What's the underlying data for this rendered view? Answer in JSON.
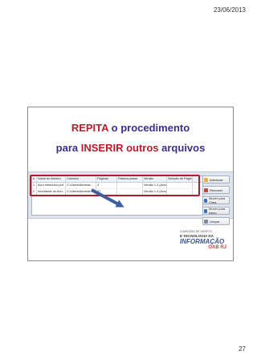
{
  "page": {
    "date": "23/06/2013",
    "number": "27"
  },
  "slide": {
    "title_line1": {
      "highlight": "REPITA",
      "rest": " o procedimento"
    },
    "title_line2": {
      "prefix": "para ",
      "highlight": "INSERIR outros",
      "suffix": " arquivos"
    }
  },
  "file_table": {
    "headers": [
      "#",
      "Nome do ficheiro",
      "Caminho",
      "Páginas",
      "Palavra-passe",
      "Versão",
      "Seleção de Páginas"
    ],
    "rows": [
      [
        "1",
        "Acro eletronico.pdf",
        "C:\\Users\\Almeida...",
        "4",
        "",
        "Versão 1.4 (Acrob...",
        ""
      ],
      [
        "2",
        "Imunidade do Ann...",
        "C:\\Users\\Almeida...",
        "37",
        "",
        "Versão 1.4 (Acrob...",
        ""
      ]
    ]
  },
  "buttons": {
    "add": "Adicionar",
    "remove": "Remover",
    "move_up": "Mover para Cima",
    "move_down": "Mover para baixo",
    "clear": "Limpar"
  },
  "logo": {
    "top": "COMISSÃO DE DIREITO",
    "tech": "E TECNOLOGIA DA",
    "info": "INFORMAÇÃO",
    "oab": "OAB RJ"
  }
}
